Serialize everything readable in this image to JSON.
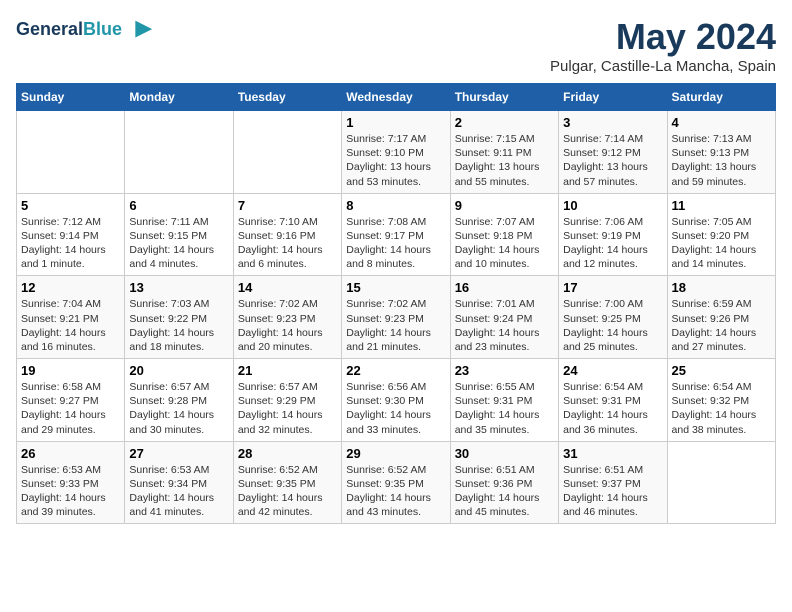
{
  "header": {
    "logo_line1": "General",
    "logo_line2": "Blue",
    "month": "May 2024",
    "location": "Pulgar, Castille-La Mancha, Spain"
  },
  "days_of_week": [
    "Sunday",
    "Monday",
    "Tuesday",
    "Wednesday",
    "Thursday",
    "Friday",
    "Saturday"
  ],
  "weeks": [
    [
      {
        "day": "",
        "info": ""
      },
      {
        "day": "",
        "info": ""
      },
      {
        "day": "",
        "info": ""
      },
      {
        "day": "1",
        "info": "Sunrise: 7:17 AM\nSunset: 9:10 PM\nDaylight: 13 hours and 53 minutes."
      },
      {
        "day": "2",
        "info": "Sunrise: 7:15 AM\nSunset: 9:11 PM\nDaylight: 13 hours and 55 minutes."
      },
      {
        "day": "3",
        "info": "Sunrise: 7:14 AM\nSunset: 9:12 PM\nDaylight: 13 hours and 57 minutes."
      },
      {
        "day": "4",
        "info": "Sunrise: 7:13 AM\nSunset: 9:13 PM\nDaylight: 13 hours and 59 minutes."
      }
    ],
    [
      {
        "day": "5",
        "info": "Sunrise: 7:12 AM\nSunset: 9:14 PM\nDaylight: 14 hours and 1 minute."
      },
      {
        "day": "6",
        "info": "Sunrise: 7:11 AM\nSunset: 9:15 PM\nDaylight: 14 hours and 4 minutes."
      },
      {
        "day": "7",
        "info": "Sunrise: 7:10 AM\nSunset: 9:16 PM\nDaylight: 14 hours and 6 minutes."
      },
      {
        "day": "8",
        "info": "Sunrise: 7:08 AM\nSunset: 9:17 PM\nDaylight: 14 hours and 8 minutes."
      },
      {
        "day": "9",
        "info": "Sunrise: 7:07 AM\nSunset: 9:18 PM\nDaylight: 14 hours and 10 minutes."
      },
      {
        "day": "10",
        "info": "Sunrise: 7:06 AM\nSunset: 9:19 PM\nDaylight: 14 hours and 12 minutes."
      },
      {
        "day": "11",
        "info": "Sunrise: 7:05 AM\nSunset: 9:20 PM\nDaylight: 14 hours and 14 minutes."
      }
    ],
    [
      {
        "day": "12",
        "info": "Sunrise: 7:04 AM\nSunset: 9:21 PM\nDaylight: 14 hours and 16 minutes."
      },
      {
        "day": "13",
        "info": "Sunrise: 7:03 AM\nSunset: 9:22 PM\nDaylight: 14 hours and 18 minutes."
      },
      {
        "day": "14",
        "info": "Sunrise: 7:02 AM\nSunset: 9:23 PM\nDaylight: 14 hours and 20 minutes."
      },
      {
        "day": "15",
        "info": "Sunrise: 7:02 AM\nSunset: 9:23 PM\nDaylight: 14 hours and 21 minutes."
      },
      {
        "day": "16",
        "info": "Sunrise: 7:01 AM\nSunset: 9:24 PM\nDaylight: 14 hours and 23 minutes."
      },
      {
        "day": "17",
        "info": "Sunrise: 7:00 AM\nSunset: 9:25 PM\nDaylight: 14 hours and 25 minutes."
      },
      {
        "day": "18",
        "info": "Sunrise: 6:59 AM\nSunset: 9:26 PM\nDaylight: 14 hours and 27 minutes."
      }
    ],
    [
      {
        "day": "19",
        "info": "Sunrise: 6:58 AM\nSunset: 9:27 PM\nDaylight: 14 hours and 29 minutes."
      },
      {
        "day": "20",
        "info": "Sunrise: 6:57 AM\nSunset: 9:28 PM\nDaylight: 14 hours and 30 minutes."
      },
      {
        "day": "21",
        "info": "Sunrise: 6:57 AM\nSunset: 9:29 PM\nDaylight: 14 hours and 32 minutes."
      },
      {
        "day": "22",
        "info": "Sunrise: 6:56 AM\nSunset: 9:30 PM\nDaylight: 14 hours and 33 minutes."
      },
      {
        "day": "23",
        "info": "Sunrise: 6:55 AM\nSunset: 9:31 PM\nDaylight: 14 hours and 35 minutes."
      },
      {
        "day": "24",
        "info": "Sunrise: 6:54 AM\nSunset: 9:31 PM\nDaylight: 14 hours and 36 minutes."
      },
      {
        "day": "25",
        "info": "Sunrise: 6:54 AM\nSunset: 9:32 PM\nDaylight: 14 hours and 38 minutes."
      }
    ],
    [
      {
        "day": "26",
        "info": "Sunrise: 6:53 AM\nSunset: 9:33 PM\nDaylight: 14 hours and 39 minutes."
      },
      {
        "day": "27",
        "info": "Sunrise: 6:53 AM\nSunset: 9:34 PM\nDaylight: 14 hours and 41 minutes."
      },
      {
        "day": "28",
        "info": "Sunrise: 6:52 AM\nSunset: 9:35 PM\nDaylight: 14 hours and 42 minutes."
      },
      {
        "day": "29",
        "info": "Sunrise: 6:52 AM\nSunset: 9:35 PM\nDaylight: 14 hours and 43 minutes."
      },
      {
        "day": "30",
        "info": "Sunrise: 6:51 AM\nSunset: 9:36 PM\nDaylight: 14 hours and 45 minutes."
      },
      {
        "day": "31",
        "info": "Sunrise: 6:51 AM\nSunset: 9:37 PM\nDaylight: 14 hours and 46 minutes."
      },
      {
        "day": "",
        "info": ""
      }
    ]
  ]
}
